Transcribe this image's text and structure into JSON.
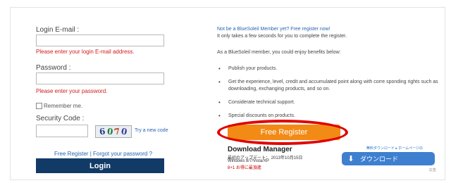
{
  "login": {
    "email_label": "Login E-mail :",
    "email_error": "Please enter your login E-mail address.",
    "password_label": "Password :",
    "password_error": "Please enter your password.",
    "remember_label": "Remember me.",
    "security_label": "Security Code :",
    "captcha_chars": [
      "6",
      "0",
      "7",
      "0"
    ],
    "new_code_link": "Try a new code",
    "register_link": "Free Register",
    "separator": " | ",
    "forgot_link": "Forgot your password ?",
    "login_button": "Login"
  },
  "register": {
    "not_member": "Not be a BlueSoleil Member yet? Free register now!",
    "takes_seconds": "It only takes a few seconds for you to complete the register.",
    "intro": "As a BlueSoleil member, you could enjoy benefits below:",
    "benefits": [
      "Publish your products.",
      "Get the experience, level, credit and accumulated point along with corre sponding rights such as downloading, exchanging products, and so on.",
      "Considerate technical support.",
      "Special discounts on products."
    ],
    "free_register_button": "Free Register"
  },
  "ad": {
    "title": "Download Manager",
    "line2": "最初のアップデート： 2013年10月15日",
    "line3": "Windows 8/7/Vista/XP",
    "line4": "8+1 お得に最頂進",
    "top_label": "無料ダウンロード ▸ ホームページの",
    "download_button": "ダウンロード",
    "corner_label": "広告"
  },
  "colors": {
    "login_button_bg": "#123a67",
    "register_button_bg": "#f28a16",
    "error_text": "#d21c1c",
    "link": "#2a64b0",
    "highlight_ellipse": "#e00000"
  }
}
